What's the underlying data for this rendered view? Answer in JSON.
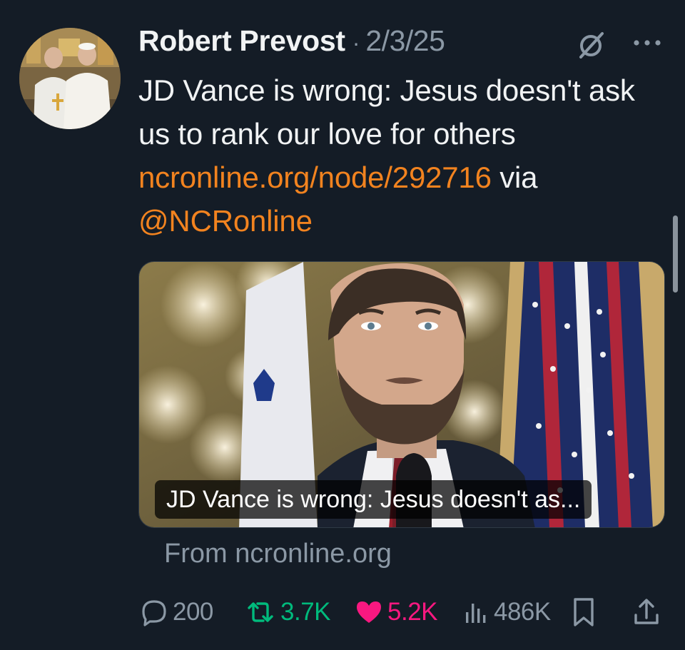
{
  "tweet": {
    "author_name": "Robert Prevost",
    "separator": "·",
    "date": "2/3/25",
    "text_line": "JD Vance is wrong: Jesus doesn't ask us to rank our love for others ",
    "link": "ncronline.org/node/292716",
    "via": " via ",
    "mention": "@NCRonline"
  },
  "card": {
    "caption": "JD Vance is wrong: Jesus doesn't as...",
    "source": "From ncronline.org"
  },
  "metrics": {
    "replies": "200",
    "reposts": "3.7K",
    "likes": "5.2K",
    "views": "486K"
  },
  "icons": {
    "reply": "reply-icon",
    "repost": "repost-icon",
    "like": "heart-icon",
    "views": "views-icon",
    "bookmark": "bookmark-icon",
    "share": "share-icon",
    "grok": "grok-icon",
    "more": "more-icon"
  },
  "colors": {
    "background": "#141c26",
    "link": "#f2831f",
    "muted": "#8b98a5",
    "repost_active": "#00ba7c",
    "like_active": "#f91880"
  }
}
